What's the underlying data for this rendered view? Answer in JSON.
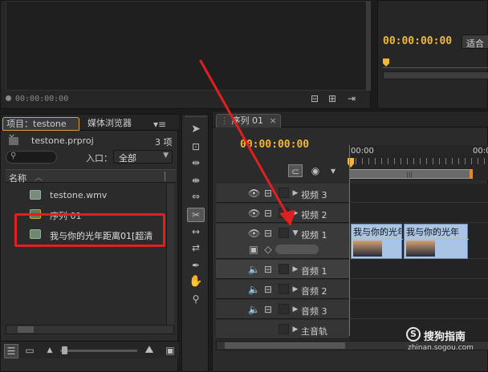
{
  "source_monitor": {
    "timecode": "00:00:00:00"
  },
  "program_monitor": {
    "timecode": "00:00:00:00",
    "fit_label": "适合"
  },
  "project_panel": {
    "tab_project": "项目：testone",
    "tab_close": "×",
    "tab_media": "媒体浏览器",
    "file_name": "testone.prproj",
    "item_count": "3 项",
    "search_placeholder": "",
    "entry_label": "入口：",
    "entry_value": "全部",
    "column_name": "名称",
    "items": [
      {
        "label": "testone.wmv"
      },
      {
        "label": "序列 01"
      },
      {
        "label": "我与你的光年距离01[超清"
      }
    ]
  },
  "timeline": {
    "tab_label": "序列 01",
    "tab_close": "×",
    "timecode": "00:00:00:00",
    "ruler_start": "00:00",
    "ruler_next": "00:0",
    "tracks": [
      {
        "label": "视频 3"
      },
      {
        "label": "视频 2"
      },
      {
        "label": "视频 1"
      },
      {
        "label": "音频 1"
      },
      {
        "label": "音频 2"
      },
      {
        "label": "音频 3"
      },
      {
        "label": "主音轨"
      }
    ],
    "clips": [
      {
        "label": "我与你的光年"
      },
      {
        "label": "我与你的光年"
      }
    ]
  },
  "watermark": {
    "brand": "搜狗指南",
    "url": "zhinan.sogou.com"
  },
  "colors": {
    "accent": "#f0b73a",
    "annotation": "#e02020",
    "clip": "#a9c4e4",
    "playhead": "#e84040"
  }
}
